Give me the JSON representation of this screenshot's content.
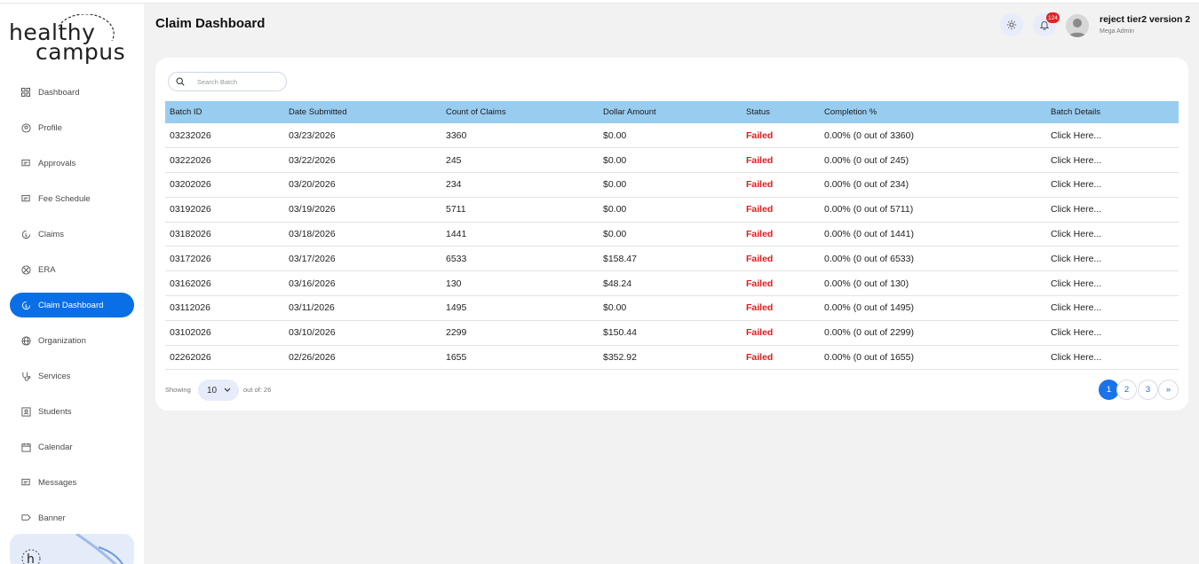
{
  "brand": {
    "line1": "healthy",
    "line2": "campus"
  },
  "header": {
    "title": "Claim Dashboard",
    "notification_count": "124",
    "user_name": "reject tier2 version 2",
    "user_role": "Mega Admin"
  },
  "sidebar": {
    "items": [
      {
        "label": "Dashboard",
        "icon": "grid-icon"
      },
      {
        "label": "Profile",
        "icon": "user-circle-icon"
      },
      {
        "label": "Approvals",
        "icon": "chat-icon"
      },
      {
        "label": "Fee Schedule",
        "icon": "chat-icon"
      },
      {
        "label": "Claims",
        "icon": "dollar-cycle-icon"
      },
      {
        "label": "ERA",
        "icon": "globe-cross-icon"
      },
      {
        "label": "Claim Dashboard",
        "icon": "dollar-cycle-icon"
      },
      {
        "label": "Organization",
        "icon": "globe-icon"
      },
      {
        "label": "Services",
        "icon": "stethoscope-icon"
      },
      {
        "label": "Students",
        "icon": "id-card-icon"
      },
      {
        "label": "Calendar",
        "icon": "calendar-icon"
      },
      {
        "label": "Messages",
        "icon": "chat-icon"
      },
      {
        "label": "Banner",
        "icon": "flag-icon"
      }
    ]
  },
  "search": {
    "placeholder": "Search Batch"
  },
  "table": {
    "headers": [
      "Batch ID",
      "Date Submitted",
      "Count of Claims",
      "Dollar Amount",
      "Status",
      "Completion %",
      "Batch Details"
    ],
    "rows": [
      [
        "03232026",
        "03/23/2026",
        "3360",
        "$0.00",
        "Failed",
        "0.00% (0 out of 3360)",
        "Click Here..."
      ],
      [
        "03222026",
        "03/22/2026",
        "245",
        "$0.00",
        "Failed",
        "0.00% (0 out of 245)",
        "Click Here..."
      ],
      [
        "03202026",
        "03/20/2026",
        "234",
        "$0.00",
        "Failed",
        "0.00% (0 out of 234)",
        "Click Here..."
      ],
      [
        "03192026",
        "03/19/2026",
        "5711",
        "$0.00",
        "Failed",
        "0.00% (0 out of 5711)",
        "Click Here..."
      ],
      [
        "03182026",
        "03/18/2026",
        "1441",
        "$0.00",
        "Failed",
        "0.00% (0 out of 1441)",
        "Click Here..."
      ],
      [
        "03172026",
        "03/17/2026",
        "6533",
        "$158.47",
        "Failed",
        "0.00% (0 out of 6533)",
        "Click Here..."
      ],
      [
        "03162026",
        "03/16/2026",
        "130",
        "$48.24",
        "Failed",
        "0.00% (0 out of 130)",
        "Click Here..."
      ],
      [
        "03112026",
        "03/11/2026",
        "1495",
        "$0.00",
        "Failed",
        "0.00% (0 out of 1495)",
        "Click Here..."
      ],
      [
        "03102026",
        "03/10/2026",
        "2299",
        "$150.44",
        "Failed",
        "0.00% (0 out of 2299)",
        "Click Here..."
      ],
      [
        "02262026",
        "02/26/2026",
        "1655",
        "$352.92",
        "Failed",
        "0.00% (0 out of 1655)",
        "Click Here..."
      ]
    ]
  },
  "footer": {
    "showing_label": "Showing",
    "page_size": "10",
    "out_of_label": "out of: 26",
    "pages": [
      "1",
      "2",
      "3"
    ],
    "next_label": "»"
  },
  "colors": {
    "accent": "#0a6fe6",
    "table_header": "#99cdf0",
    "failed": "#e01b1b"
  }
}
